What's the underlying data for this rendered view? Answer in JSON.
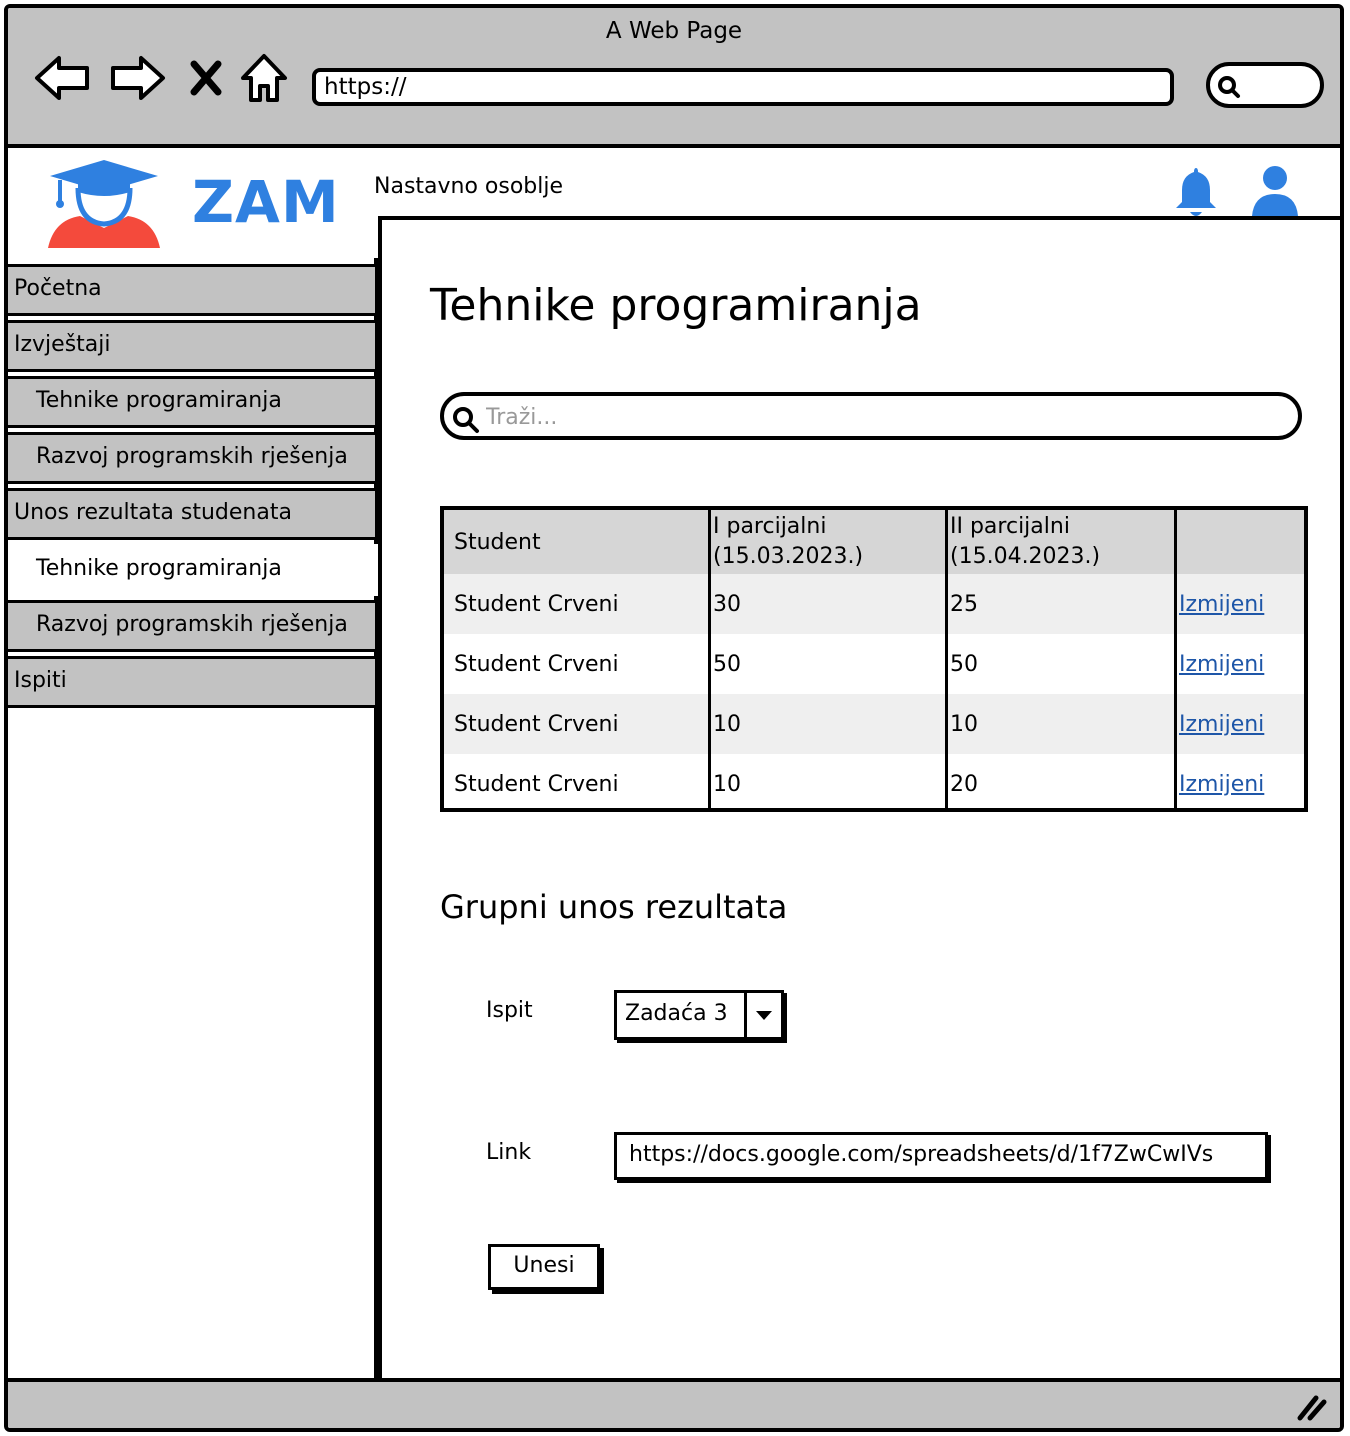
{
  "window": {
    "title": "A Web Page"
  },
  "browser": {
    "url": "https://"
  },
  "header": {
    "brand": "ZAM",
    "section": "Nastavno osoblje"
  },
  "sidebar": {
    "items": [
      {
        "label": "Početna",
        "level": 0,
        "active": false
      },
      {
        "label": "Izvještaji",
        "level": 0,
        "active": false
      },
      {
        "label": "Tehnike programiranja",
        "level": 1,
        "active": false
      },
      {
        "label": "Razvoj programskih rješenja",
        "level": 1,
        "active": false
      },
      {
        "label": "Unos rezultata studenata",
        "level": 0,
        "active": false
      },
      {
        "label": "Tehnike programiranja",
        "level": 1,
        "active": true
      },
      {
        "label": "Razvoj programskih rješenja",
        "level": 1,
        "active": false
      },
      {
        "label": "Ispiti",
        "level": 0,
        "active": false
      }
    ]
  },
  "main": {
    "title": "Tehnike programiranja",
    "search": {
      "placeholder": "Traži..."
    },
    "table": {
      "headers": [
        "Student",
        "I parcijalni\n(15.03.2023.)",
        "II parcijalni\n(15.04.2023.)",
        ""
      ],
      "rows": [
        {
          "student": "Student Crveni",
          "p1": "30",
          "p2": "25",
          "action": "Izmijeni"
        },
        {
          "student": "Student Crveni",
          "p1": "50",
          "p2": "50",
          "action": "Izmijeni"
        },
        {
          "student": "Student Crveni",
          "p1": "10",
          "p2": "10",
          "action": "Izmijeni"
        },
        {
          "student": "Student Crveni",
          "p1": "10",
          "p2": "20",
          "action": "Izmijeni"
        }
      ]
    },
    "group": {
      "title": "Grupni unos rezultata",
      "exam_label": "Ispit",
      "exam_value": "Zadaća 3",
      "link_label": "Link",
      "link_value": "https://docs.google.com/spreadsheets/d/1f7ZwCwIVs",
      "submit_label": "Unesi"
    }
  },
  "colors": {
    "brand": "#2f80e0",
    "chrome": "#c2c2c2",
    "link": "#1e56a8",
    "avatar_shirt": "#f44a3c"
  }
}
